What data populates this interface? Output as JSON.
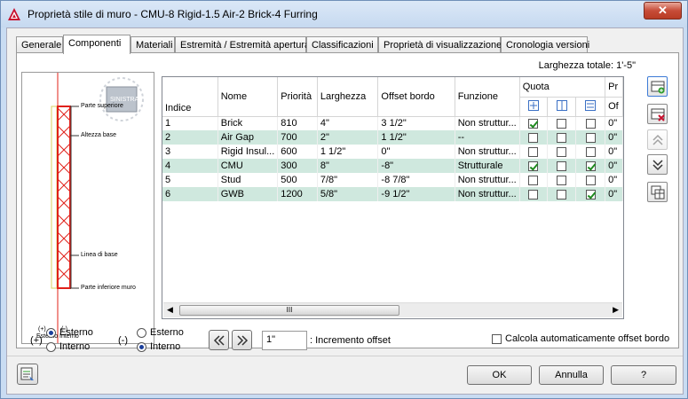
{
  "window": {
    "title": "Proprietà stile di muro - CMU-8 Rigid-1.5 Air-2 Brick-4 Furring",
    "close": "✕"
  },
  "tabs": [
    "Generale",
    "Componenti",
    "Materiali",
    "Estremità / Estremità apertura",
    "Classificazioni",
    "Proprietà di visualizzazione",
    "Cronologia versioni"
  ],
  "total_width": "Larghezza totale: 1'-5\"",
  "preview": {
    "view_cube": "SINISTRA",
    "labels": [
      "Parte superiore",
      "Altezza base",
      "Linea di base",
      "Parte inferiore muro"
    ],
    "bottom_plus": "(+)",
    "bottom_minus": "(-)",
    "bottom_ext": "Esterno",
    "bottom_int": "Interno"
  },
  "grid": {
    "headers": {
      "indice": "Indice",
      "nome": "Nome",
      "priorita": "Priorità",
      "larghezza": "Larghezza",
      "offset": "Offset bordo",
      "funzione": "Funzione",
      "quota": "Quota",
      "pr": "Pr",
      "of": "Of"
    },
    "rows": [
      {
        "indice": "1",
        "nome": "Brick",
        "priorita": "810",
        "larghezza": "4\"",
        "offset": "3 1/2\"",
        "funzione": "Non struttur...",
        "q1": true,
        "q2": false,
        "q3": false,
        "pr": "0\""
      },
      {
        "indice": "2",
        "nome": "Air Gap",
        "priorita": "700",
        "larghezza": "2\"",
        "offset": "1 1/2\"",
        "funzione": "--",
        "q1": false,
        "q2": false,
        "q3": false,
        "pr": "0\""
      },
      {
        "indice": "3",
        "nome": "Rigid Insul...",
        "priorita": "600",
        "larghezza": "1 1/2\"",
        "offset": "0\"",
        "funzione": "Non struttur...",
        "q1": false,
        "q2": false,
        "q3": false,
        "pr": "0\""
      },
      {
        "indice": "4",
        "nome": "CMU",
        "priorita": "300",
        "larghezza": "8\"",
        "offset": "-8\"",
        "funzione": "Strutturale",
        "q1": true,
        "q2": false,
        "q3": true,
        "pr": "0\""
      },
      {
        "indice": "5",
        "nome": "Stud",
        "priorita": "500",
        "larghezza": "7/8\"",
        "offset": "-8 7/8\"",
        "funzione": "Non struttur...",
        "q1": false,
        "q2": false,
        "q3": false,
        "pr": "0\""
      },
      {
        "indice": "6",
        "nome": "GWB",
        "priorita": "1200",
        "larghezza": "5/8\"",
        "offset": "-9 1/2\"",
        "funzione": "Non struttur...",
        "q1": false,
        "q2": false,
        "q3": true,
        "pr": "0\""
      }
    ],
    "scroll_thumb": "III"
  },
  "options": {
    "plus": "(+)",
    "minus": "(-)",
    "esterno": "Esterno",
    "interno": "Interno",
    "plus_selected": "Esterno",
    "minus_selected": "Interno"
  },
  "offset": {
    "value": "1\"",
    "label": ": Incremento offset",
    "auto": "Calcola automaticamente offset bordo",
    "auto_checked": false
  },
  "buttons": {
    "ok": "OK",
    "cancel": "Annulla",
    "help": "?"
  },
  "colors": {
    "accent": "#1e8a1e",
    "alt_row": "#cfe8de",
    "wall_red": "#e0201a",
    "insul_yellow": "#e8e070"
  }
}
